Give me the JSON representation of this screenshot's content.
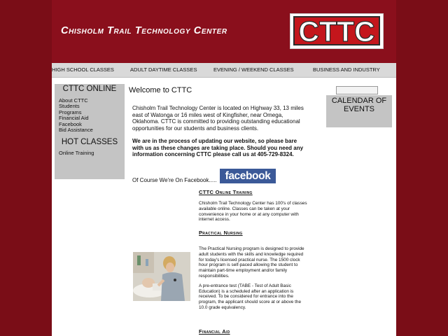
{
  "header": {
    "site_title": "Chisholm Trail Technology Center",
    "logo_text": "CTTC",
    "colors": {
      "background": "#7a0d17",
      "header": "#8a0f1c",
      "logo_red": "#c4161c"
    }
  },
  "nav": {
    "items": [
      {
        "label": "High School Classes"
      },
      {
        "label": "Adult Daytime Classes"
      },
      {
        "label": "Evening / Weekend Classes"
      },
      {
        "label": "Business and Industry"
      }
    ]
  },
  "sidebar": {
    "online_heading": "CTTC ONLINE",
    "links": [
      {
        "label": "About CTTC"
      },
      {
        "label": "Students"
      },
      {
        "label": "Programs"
      },
      {
        "label": "Financial Aid"
      },
      {
        "label": "Facebook"
      },
      {
        "label": "Bid Assistance"
      }
    ],
    "hot_heading": "HOT CLASSES",
    "hot_links": [
      {
        "label": "Online Training"
      }
    ]
  },
  "calendar": {
    "input_value": "",
    "label": "CALENDAR OF EVENTS"
  },
  "main": {
    "welcome": "Welcome to CTTC",
    "intro": "Chisholm Trail Technology Center is located on Highway 33, 13 miles east of Watonga or 16 miles west of Kingfisher, near Omega, Oklahoma. CTTC is committed to providing outstanding educational opportunities for our students and business clients.",
    "notice": "We are in the process of updating our website, so please bare with us as these changes are taking place.  Should you need any information concerning CTTC please call us at 405-729-8324.",
    "facebook_line": "Of Course We're On Facebook.....",
    "facebook_logo": "facebook",
    "sections": [
      {
        "title": "CTTC Online Training",
        "paragraphs": [
          "Chisholm Trail Technology Center has 100's of classes available online.  Classes can be taken at your convenience in your home or at any computer with internet access."
        ]
      },
      {
        "title": "Practical Nursing",
        "paragraphs": [
          "The Practical Nursing program is designed to provide adult students with the skills and knowledge required for today's licensed practical nurse. The 1500 clock hour program is self-paced allowing the student to maintain part-time employment and/or family responsibilities.",
          "A pre-entrance test (TABE - Test of Adult Basic Education) is a scheduled after an application is received. To be considered for entrance into the program, the applicant should score at or above the 10.0 grade equivalency."
        ]
      },
      {
        "title": "Financial Aid",
        "paragraphs": []
      }
    ]
  }
}
